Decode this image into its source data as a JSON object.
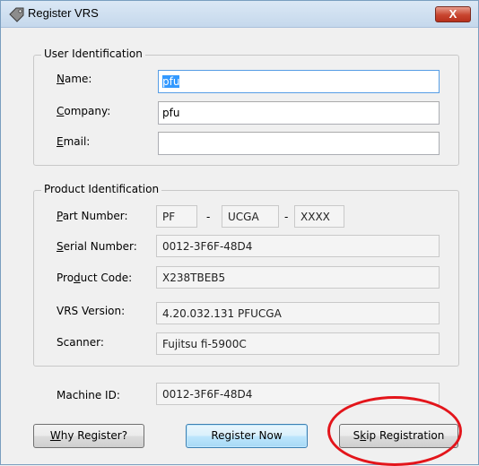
{
  "window": {
    "title": "Register VRS",
    "close_label": "X"
  },
  "user_identification": {
    "legend": "User Identification",
    "name": {
      "label_mn": "N",
      "label_rest": "ame:",
      "value": "pfu"
    },
    "company": {
      "label_mn": "C",
      "label_rest": "ompany:",
      "value": "pfu"
    },
    "email": {
      "label_mn": "E",
      "label_rest": "mail:",
      "value": ""
    }
  },
  "product_identification": {
    "legend": "Product Identification",
    "part_number": {
      "label_mn": "P",
      "label_rest": "art Number:",
      "part1": "PF",
      "part2": "UCGA",
      "part3": "XXXX",
      "sep": "-"
    },
    "serial_number": {
      "label_mn": "S",
      "label_rest": "erial Number:",
      "value": "0012-3F6F-48D4"
    },
    "product_code": {
      "label_pre": "Pro",
      "label_mn": "d",
      "label_rest": "uct Code:",
      "value": "X238TBEB5"
    },
    "vrs_version": {
      "label": "VRS Version:",
      "value": "4.20.032.131 PFUCGA"
    },
    "scanner": {
      "label": "Scanner:",
      "value": "Fujitsu fi-5900C"
    }
  },
  "machine": {
    "label": "Machine ID:",
    "value": "0012-3F6F-48D4"
  },
  "buttons": {
    "why_register": {
      "mn": "W",
      "rest": "hy Register?"
    },
    "register_now": {
      "label": "Register Now"
    },
    "skip_registration": {
      "pre": "S",
      "mn": "k",
      "rest": "ip Registration"
    }
  },
  "colors": {
    "annotation_ellipse": "#e3151b",
    "selection": "#3399ff"
  }
}
